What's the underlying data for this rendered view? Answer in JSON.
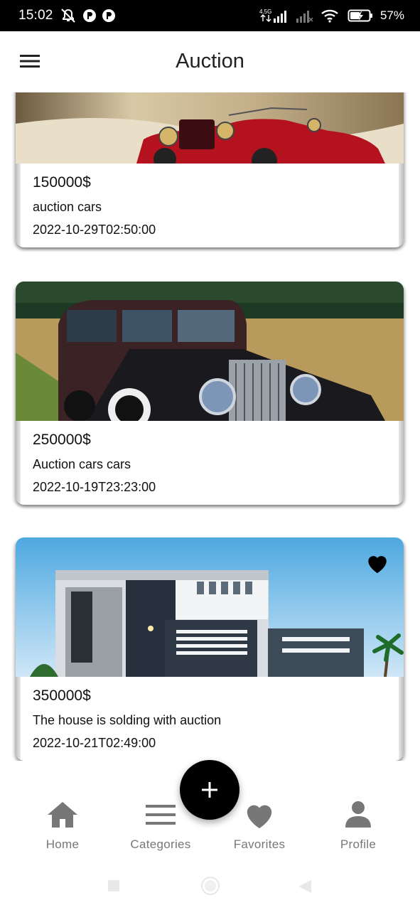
{
  "status_bar": {
    "time": "15:02",
    "network_label": "4.5G",
    "battery_percent": "57%",
    "icons": [
      "mute-notifications-icon",
      "app-notification-icon",
      "app-notification-icon",
      "signal-icon",
      "no-signal-icon",
      "wifi-icon",
      "battery-charging-icon"
    ]
  },
  "app_bar": {
    "title": "Auction",
    "menu_icon": "hamburger-menu-icon"
  },
  "listings": [
    {
      "price": "150000$",
      "title": "auction cars",
      "date": "2022-10-29T02:50:00",
      "image": "red vintage car",
      "favorited": false
    },
    {
      "price": "250000$",
      "title": "Auction cars cars",
      "date": "2022-10-19T23:23:00",
      "image": "dark vintage limousine in field",
      "favorited": false
    },
    {
      "price": "350000$",
      "title": "The house is solding with auction",
      "date": "2022-10-21T02:49:00",
      "image": "modern house facade",
      "favorited": true
    }
  ],
  "fab": {
    "icon": "plus-icon"
  },
  "bottom_nav": [
    {
      "label": "Home",
      "icon": "home-icon"
    },
    {
      "label": "Categories",
      "icon": "list-icon"
    },
    {
      "label": "Favorites",
      "icon": "heart-icon"
    },
    {
      "label": "Profile",
      "icon": "person-icon"
    }
  ],
  "colors": {
    "accent": "#000000",
    "nav_inactive": "#777777",
    "status_bar": "#000000"
  }
}
